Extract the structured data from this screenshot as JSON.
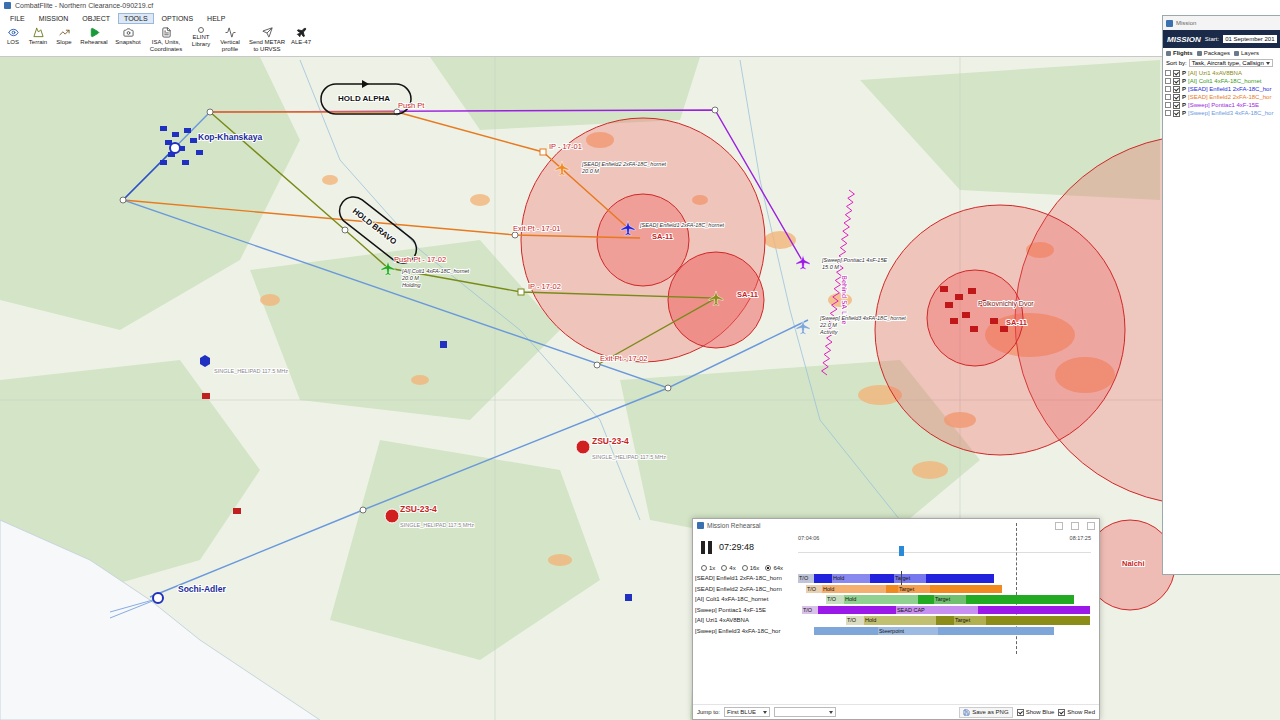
{
  "window": {
    "title": "CombatFlite - Northern Clearance-090219.cf"
  },
  "menu": [
    {
      "label": "FILE",
      "selected": false
    },
    {
      "label": "MISSION",
      "selected": false
    },
    {
      "label": "OBJECT",
      "selected": false
    },
    {
      "label": "TOOLS",
      "selected": true
    },
    {
      "label": "OPTIONS",
      "selected": false
    },
    {
      "label": "HELP",
      "selected": false
    }
  ],
  "toolbar": [
    {
      "label": "LOS"
    },
    {
      "label": "Terrain"
    },
    {
      "label": "Slope"
    },
    {
      "label": "Rehearsal"
    },
    {
      "label": "Snapshot"
    },
    {
      "label": "ISA, Units, Coordinates"
    },
    {
      "label": "ELINT Library"
    },
    {
      "label": "Vertical profile"
    },
    {
      "label": "Send METAR to URVSS"
    },
    {
      "label": "ALE-47"
    }
  ],
  "map": {
    "labels": [
      {
        "text": "HOLD ALPHA",
        "color": "#111111"
      },
      {
        "text": "HOLD BRAVO",
        "color": "#111111"
      },
      {
        "text": "Push Pt",
        "color": "#c81e1e"
      },
      {
        "text": "IP - 17-01",
        "color": "#c81e1e"
      },
      {
        "text": "Exit Pt - 17-01",
        "color": "#c81e1e"
      },
      {
        "text": "IP - 17-02",
        "color": "#c81e1e"
      },
      {
        "text": "Exit Pt - 17-02",
        "color": "#c81e1e"
      },
      {
        "text": "Push Pt - 17-02",
        "color": "#c81e1e"
      },
      {
        "text": "Kop-Khanskaya",
        "color": "#1a2a9a"
      },
      {
        "text": "Sochi-Adler",
        "color": "#1a2a9a"
      },
      {
        "text": "ZSU-23-4",
        "color": "#c81e1e"
      },
      {
        "text": "ZSU-23-4",
        "color": "#c81e1e"
      },
      {
        "text": "SINGLE_HELIPAD 117.5 MHz",
        "color": "#888888"
      },
      {
        "text": "SINGLE_HELIPAD 117.5 MHz",
        "color": "#888888"
      },
      {
        "text": "SINGLE_HELIPAD 117.5 MHz",
        "color": "#888888"
      },
      {
        "text": "SA-11",
        "color": "#c81e1e"
      },
      {
        "text": "SA-11",
        "color": "#c81e1e"
      },
      {
        "text": "Polkovnichiy Dvor",
        "color": "#7a1010"
      },
      {
        "text": "SA-11",
        "color": "#c81e1e"
      },
      {
        "text": "Nalchi",
        "color": "#c81e1e"
      }
    ],
    "tags": [
      {
        "lines": [
          "[SEAD] Enfield2 2xFA-18C_hornet",
          "20.0 M"
        ]
      },
      {
        "lines": [
          "[SEAD] Enfield1 2xFA-18C_hornet"
        ]
      },
      {
        "lines": [
          "[AI] Colt1 4xFA-18C_hornet",
          "20.0 M",
          "Holding"
        ]
      },
      {
        "lines": [
          "[Sweep] Pontiac1 4xF-15E",
          "15.0 M"
        ]
      },
      {
        "lines": [
          "[Sweep] Enfield3 4xFA-18C_hornet",
          "22.0 M",
          "Activity"
        ]
      }
    ],
    "sead_line": "Behind SA Line"
  },
  "mission_panel": {
    "title": "Mission",
    "header": "MISSION",
    "start_label": "Start:",
    "start_value": "01 September 201",
    "tabs": [
      {
        "label": "Flights",
        "selected": true
      },
      {
        "label": "Packages",
        "selected": false
      },
      {
        "label": "Layers",
        "selected": false
      }
    ],
    "sort_label": "Sort by:",
    "sort_value": "Task, Aircraft type, Callsign",
    "flights": [
      {
        "label": "[AI] Uzi1 4xAV8BNA",
        "flag": "P",
        "checked": true,
        "color": "#8a8a10"
      },
      {
        "label": "[AI] Colt1 4xFA-18C_hornet",
        "flag": "P",
        "checked": true,
        "color": "#3a9a1a"
      },
      {
        "label": "[SEAD] Enfield1 2xFA-18C_hor",
        "flag": "P",
        "checked": true,
        "color": "#1a2ad8"
      },
      {
        "label": "[SEAD] Enfield2 2xFA-18C_hor",
        "flag": "P",
        "checked": true,
        "color": "#e8791e"
      },
      {
        "label": "[Sweep] Pontiac1 4xF-15E",
        "flag": "P",
        "checked": true,
        "color": "#9b1fe0"
      },
      {
        "label": "[Sweep] Enfield3 4xFA-18C_hor",
        "flag": "P",
        "checked": true,
        "color": "#6a98dc"
      }
    ]
  },
  "rehearsal": {
    "title": "Mission Rehearsal",
    "playing": true,
    "time": "07:29:48",
    "axis_start": "07:04:06",
    "axis_end": "08:17:25",
    "axis_minutes": 73.3,
    "cursor": 25.7,
    "end_marker": 54.5,
    "speeds": [
      {
        "label": "1x",
        "selected": false
      },
      {
        "label": "4x",
        "selected": false
      },
      {
        "label": "16x",
        "selected": false
      },
      {
        "label": "64x",
        "selected": true
      }
    ],
    "rows": [
      {
        "label": "[SEAD] Enfield1 2xFA-18C_horn",
        "color": "#2222dd",
        "segments": [
          {
            "label": "T/O",
            "from": 0,
            "to": 4,
            "color": "#c0c4d8"
          },
          {
            "label": "",
            "from": 4,
            "to": 8.5,
            "color": "#2222dd"
          },
          {
            "label": "Hold",
            "from": 8.5,
            "to": 18,
            "color": "#8888ee"
          },
          {
            "label": "",
            "from": 18,
            "to": 24,
            "color": "#2222dd"
          },
          {
            "label": "Target",
            "from": 24,
            "to": 32,
            "color": "#7777ee"
          },
          {
            "label": "",
            "from": 32,
            "to": 49,
            "color": "#2222dd"
          }
        ]
      },
      {
        "label": "[SEAD] Enfield2 2xFA-18C_horn",
        "color": "#f08a20",
        "segments": [
          {
            "label": "T/O",
            "from": 2,
            "to": 6,
            "color": "#e8d0b0"
          },
          {
            "label": "Hold",
            "from": 6,
            "to": 22,
            "color": "#f4b070"
          },
          {
            "label": "",
            "from": 22,
            "to": 25,
            "color": "#f08a20"
          },
          {
            "label": "Target",
            "from": 25,
            "to": 33,
            "color": "#f4a050"
          },
          {
            "label": "",
            "from": 33,
            "to": 51,
            "color": "#f08a20"
          }
        ]
      },
      {
        "label": "[AI] Colt1 4xFA-18C_hornet",
        "color": "#22aa22",
        "segments": [
          {
            "label": "T/O",
            "from": 7,
            "to": 11.5,
            "color": "#c8e0c0"
          },
          {
            "label": "Hold",
            "from": 11.5,
            "to": 30,
            "color": "#90d090"
          },
          {
            "label": "",
            "from": 30,
            "to": 34,
            "color": "#22aa22"
          },
          {
            "label": "Target",
            "from": 34,
            "to": 42,
            "color": "#70c070"
          },
          {
            "label": "",
            "from": 42,
            "to": 69,
            "color": "#22aa22"
          }
        ]
      },
      {
        "label": "[Sweep] Pontiac1 4xF-15E",
        "color": "#9a18e8",
        "segments": [
          {
            "label": "T/O",
            "from": 1,
            "to": 5,
            "color": "#d8c0e8"
          },
          {
            "label": "",
            "from": 5,
            "to": 24.5,
            "color": "#9a18e8"
          },
          {
            "label": "SEAD CAP",
            "from": 24.5,
            "to": 45,
            "color": "#c890f0"
          },
          {
            "label": "",
            "from": 45,
            "to": 73,
            "color": "#9a18e8"
          }
        ]
      },
      {
        "label": "[AI] Uzi1 4xAV8BNA",
        "color": "#8c8c18",
        "segments": [
          {
            "label": "T/O",
            "from": 12,
            "to": 16.5,
            "color": "#dcdcc0"
          },
          {
            "label": "Hold",
            "from": 16.5,
            "to": 34.5,
            "color": "#c0c070"
          },
          {
            "label": "",
            "from": 34.5,
            "to": 39,
            "color": "#8c8c18"
          },
          {
            "label": "Target",
            "from": 39,
            "to": 47,
            "color": "#b0b050"
          },
          {
            "label": "",
            "from": 47,
            "to": 73,
            "color": "#8c8c18"
          }
        ]
      },
      {
        "label": "[Sweep] Enfield3 4xFA-18C_hor",
        "color": "#7ea6d8",
        "segments": [
          {
            "label": "",
            "from": 4,
            "to": 20,
            "color": "#7ea6d8"
          },
          {
            "label": "Steerpoint",
            "from": 20,
            "to": 35,
            "color": "#9dbbe2"
          },
          {
            "label": "",
            "from": 35,
            "to": 64,
            "color": "#7ea6d8"
          }
        ]
      }
    ],
    "jump_label": "Jump to:",
    "jump_value": "First BLUE",
    "save": "Save as PNG",
    "show_blue": {
      "label": "Show Blue",
      "checked": true
    },
    "show_red": {
      "label": "Show Red",
      "checked": true
    }
  }
}
